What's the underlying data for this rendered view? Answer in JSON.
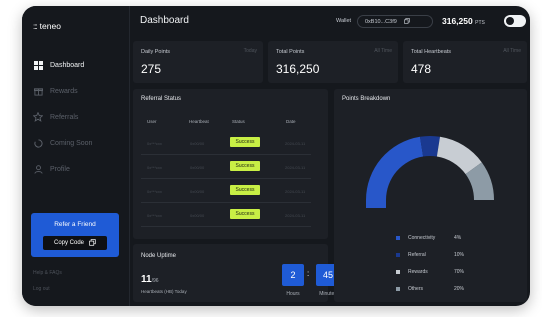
{
  "app": {
    "logo_icon": ":::",
    "logo_text": "teneo"
  },
  "sidebar": {
    "items": [
      {
        "label": "Dashboard",
        "icon": "grid-icon",
        "active": true
      },
      {
        "label": "Rewards",
        "icon": "gift-icon"
      },
      {
        "label": "Referrals",
        "icon": "star-icon"
      },
      {
        "label": "Coming Soon",
        "icon": "loading-icon"
      },
      {
        "label": "Profile",
        "icon": "user-icon"
      }
    ],
    "refer": {
      "title": "Refer a Friend",
      "copy_label": "Copy Code",
      "copy_icon": "copy-icon"
    },
    "footer": {
      "help": "Help & FAQs",
      "logout": "Log out"
    }
  },
  "header": {
    "title": "Dashboard",
    "wallet_label": "Wallet",
    "wallet_address": "0xB10...C3f9",
    "points_value": "316,250",
    "points_unit": "PTS",
    "theme_toggle": "on"
  },
  "stats": [
    {
      "label": "Daily Points",
      "tag": "Today",
      "value": "275"
    },
    {
      "label": "Total Points",
      "tag": "All Time",
      "value": "316,250"
    },
    {
      "label": "Total Heartbeats",
      "tag": "All Time",
      "value": "478"
    }
  ],
  "referral": {
    "title": "Referral Status",
    "columns": [
      "User",
      "Heartbeat",
      "Status",
      "Date"
    ],
    "rows": [
      {
        "user": "0x***cxx",
        "heartbeat": "0x00/00",
        "status": "Success",
        "date": "2024-03-11"
      },
      {
        "user": "0x***cxx",
        "heartbeat": "0x00/00",
        "status": "Success",
        "date": "2024-03-11"
      },
      {
        "user": "0x***cxx",
        "heartbeat": "0x00/00",
        "status": "Success",
        "date": "2024-03-11"
      },
      {
        "user": "0x***cxx",
        "heartbeat": "0x00/00",
        "status": "Success",
        "date": "2024-03-11"
      }
    ]
  },
  "uptime": {
    "title": "Node Uptime",
    "value": "11",
    "unit": "/96",
    "subtitle": "Heartbeats (HB) Today",
    "hours": "2",
    "minutes": "45",
    "hours_label": "Hours",
    "minutes_label": "Minutes"
  },
  "breakdown": {
    "title": "Points Breakdown",
    "segments": [
      {
        "name": "Connectivity",
        "percent": 45,
        "color": "#2857c9"
      },
      {
        "name": "Referral",
        "percent": 10,
        "color": "#1a3990"
      },
      {
        "name": "Rewards",
        "percent": 25,
        "color": "#c8cdd3"
      },
      {
        "name": "Others",
        "percent": 20,
        "color": "#8d9ba6"
      }
    ],
    "percent_labels": [
      "4%",
      "10%",
      "70%",
      "20%"
    ]
  }
}
